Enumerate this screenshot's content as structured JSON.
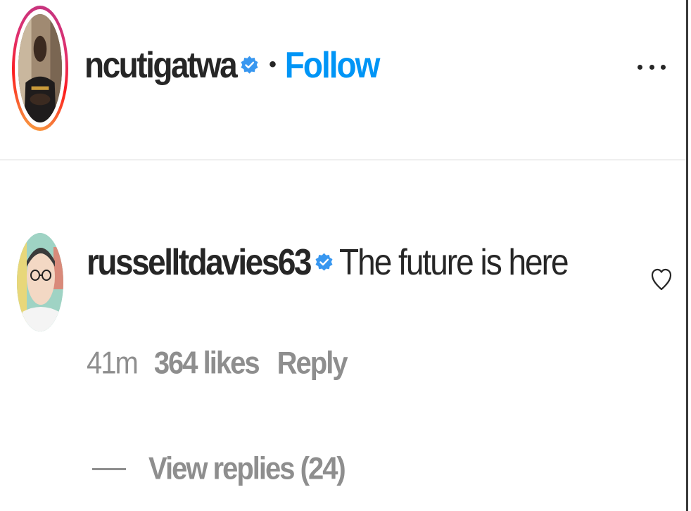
{
  "post_header": {
    "username": "ncutigatwa",
    "separator": "•",
    "follow_label": "Follow",
    "verified_icon": "verified-badge-icon",
    "more_icon": "more-options-icon"
  },
  "comment": {
    "username": "russelltdavies63",
    "text": "The future is here",
    "verified_icon": "verified-badge-icon",
    "like_icon": "heart-outline-icon",
    "time": "41m",
    "likes": "364 likes",
    "reply_label": "Reply",
    "view_replies": "View replies (24)"
  },
  "colors": {
    "accent": "#0095f6",
    "verified": "#3897f0",
    "text": "#262626",
    "muted": "#8e8e8e",
    "divider": "#efefef"
  }
}
